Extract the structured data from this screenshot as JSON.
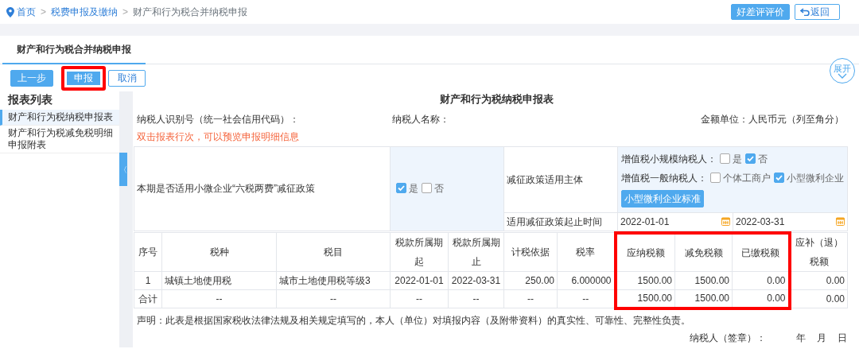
{
  "breadcrumb": [
    {
      "label": "首页",
      "link": true
    },
    {
      "label": "税费申报及缴纳",
      "link": true,
      "separator": ">"
    },
    {
      "label": "财产和行为税合并纳税申报",
      "link": false,
      "separator": ">"
    }
  ],
  "header_buttons": [
    {
      "label": "好差评评价",
      "kind": "primary"
    },
    {
      "label": "返回",
      "kind": "back"
    }
  ],
  "tab": {
    "label": "财产和行为税合并纳税申报",
    "selected": true
  },
  "actions": [
    {
      "label": "上一步",
      "kind": "primary",
      "highlighted": false
    },
    {
      "label": "申报",
      "kind": "primary",
      "highlighted": true
    },
    {
      "label": "取消",
      "kind": "outline",
      "highlighted": false
    }
  ],
  "expand_button": "展开",
  "collapse_handle": "〈",
  "sidebar": {
    "title": "报表列表",
    "items": [
      {
        "label": "财产和行为税纳税申报表",
        "selected": true
      },
      {
        "label": "财产和行为税减免税明细申报附表",
        "selected": false
      }
    ]
  },
  "form": {
    "title": "财产和行为税纳税申报表",
    "taxpayer_id_label": "纳税人识别号（统一社会信用代码）：",
    "taxpayer_name_label": "纳税人名称：",
    "unit": "金额单位：人民币元（列至角分）",
    "hint": "双击报表行次，可以预览申报明细信息",
    "policy": {
      "question": "本期是否适用小微企业“六税两费”减征政策",
      "answer_options": [
        {
          "label": "是",
          "checked": true
        },
        {
          "label": "否",
          "checked": false
        }
      ],
      "subject_label": "减征政策适用主体",
      "subject_groups": [
        {
          "label": "增值税小规模纳税人：",
          "options": [
            {
              "label": "是",
              "checked": false
            },
            {
              "label": "否",
              "checked": true
            }
          ]
        },
        {
          "label": "增值税一般纳税人：",
          "options": [
            {
              "label": "个体工商户",
              "checked": false
            },
            {
              "label": "小型微利企业",
              "checked": true
            }
          ]
        }
      ],
      "standard_button": "小型微利企业标准",
      "period_label": "适用减征政策起止时间",
      "period_start": "2022-01-01",
      "period_end": "2022-03-31"
    },
    "table": {
      "columns": [
        {
          "label": "序号",
          "highlighted": false
        },
        {
          "label": "税种",
          "highlighted": false
        },
        {
          "label": "税目",
          "highlighted": false
        },
        {
          "label": "税款所属期起",
          "highlighted": false
        },
        {
          "label": "税款所属期止",
          "highlighted": false
        },
        {
          "label": "计税依据",
          "highlighted": false
        },
        {
          "label": "税率",
          "highlighted": false
        },
        {
          "label": "应纳税额",
          "highlighted": true
        },
        {
          "label": "减免税额",
          "highlighted": true
        },
        {
          "label": "已缴税额",
          "highlighted": true
        },
        {
          "label": "应补（退）税额",
          "highlighted": false
        }
      ],
      "rows": [
        [
          "1",
          "城镇土地使用税",
          "城市土地使用税等级3",
          "2022-01-01",
          "2022-03-31",
          "250.00",
          "6.000000",
          "1500.00",
          "1500.00",
          "0.00",
          "0.00"
        ],
        [
          "合计",
          "--",
          "--",
          "--",
          "--",
          "--",
          "--",
          "1500.00",
          "1500.00",
          "0.00",
          "0.00"
        ]
      ]
    },
    "declaration": "声明：此表是根据国家税收法律法规及相关规定填写的，本人（单位）对填报内容（及附带资料）的真实性、可靠性、完整性负责。",
    "signature": {
      "label": "纳税人（签章）：",
      "year": "年",
      "month": "月",
      "day": "日"
    }
  }
}
